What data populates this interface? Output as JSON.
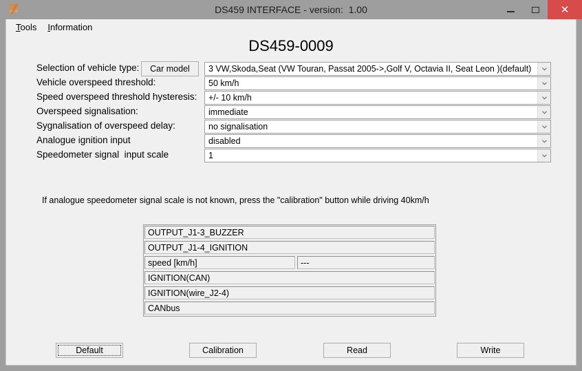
{
  "window": {
    "title": "DS459 INTERFACE - version:  1.00",
    "icon": "app-logo-icon",
    "minimize_label": "–",
    "maximize_label": "□",
    "close_label": "✕",
    "close_color": "#d74b4b",
    "titlebar_color": "#9e9e9e",
    "client_color": "#f0f0f0"
  },
  "menu": {
    "items": [
      {
        "mnemonic": "T",
        "rest": "ools"
      },
      {
        "mnemonic": "I",
        "rest": "nformation"
      }
    ]
  },
  "page": {
    "title": "DS459-0009"
  },
  "form": {
    "car_model_button": "Car model",
    "rows": [
      {
        "label": "Selection of vehicle type:",
        "value": "3 VW,Skoda,Seat (VW Touran, Passat 2005->,Golf V, Octavia II, Seat Leon )(default)"
      },
      {
        "label": "Vehicle overspeed threshold:",
        "value": "50 km/h"
      },
      {
        "label": "Speed overspeed threshold hysteresis:",
        "value": "+/- 10 km/h"
      },
      {
        "label": "Overspeed signalisation:",
        "value": "immediate"
      },
      {
        "label": "Sygnalisation of overspeed delay:",
        "value": "no signalisation"
      },
      {
        "label": "Analogue ignition input",
        "value": "disabled"
      },
      {
        "label": "Speedometer signal  input scale",
        "value": "1"
      }
    ]
  },
  "hint": {
    "text": "If analogue speedometer signal scale is not known, press the \"calibration\" button while driving 40km/h"
  },
  "status_table": {
    "rows": [
      {
        "label": "OUTPUT_J1-3_BUZZER",
        "value": null,
        "split": false
      },
      {
        "label": "OUTPUT_J1-4_IGNITION",
        "value": null,
        "split": false
      },
      {
        "label": "speed [km/h]",
        "value": "---",
        "split": true
      },
      {
        "label": "IGNITION(CAN)",
        "value": null,
        "split": false
      },
      {
        "label": "IGNITION(wire_J2-4)",
        "value": null,
        "split": false
      },
      {
        "label": "CANbus",
        "value": null,
        "split": false
      }
    ]
  },
  "buttons": {
    "default": "Default",
    "calibration": "Calibration",
    "read": "Read",
    "write": "Write"
  }
}
